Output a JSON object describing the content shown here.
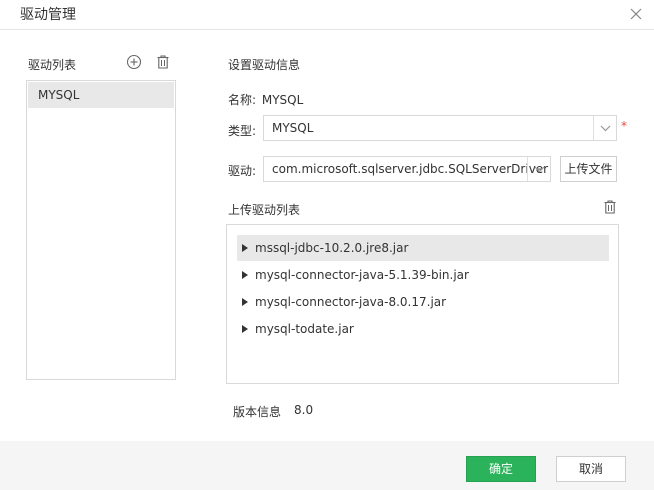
{
  "dialog": {
    "title": "驱动管理",
    "close_icon": "close-icon"
  },
  "left_panel": {
    "title": "驱动列表",
    "add_icon": "plus-circle-icon",
    "delete_icon": "trash-icon",
    "items": [
      {
        "label": "MYSQL",
        "selected": true
      }
    ]
  },
  "right_panel": {
    "section_title": "设置驱动信息",
    "name_label": "名称:",
    "name_value": "MYSQL",
    "type_label": "类型:",
    "type_value": "MYSQL",
    "required_mark": "*",
    "driver_label": "驱动:",
    "driver_value": "com.microsoft.sqlserver.jdbc.SQLServerDriver",
    "upload_button": "上传文件",
    "upload_list_title": "上传驱动列表",
    "jars": [
      {
        "name": "mssql-jdbc-10.2.0.jre8.jar",
        "selected": true
      },
      {
        "name": "mysql-connector-java-5.1.39-bin.jar",
        "selected": false
      },
      {
        "name": "mysql-connector-java-8.0.17.jar",
        "selected": false
      },
      {
        "name": "mysql-todate.jar",
        "selected": false
      }
    ],
    "version_label": "版本信息",
    "version_value": "8.0"
  },
  "footer": {
    "ok_label": "确定",
    "cancel_label": "取消"
  },
  "colors": {
    "primary": "#2bb35b",
    "required": "#e74c3c",
    "selected_bg": "#e8e8e8"
  }
}
